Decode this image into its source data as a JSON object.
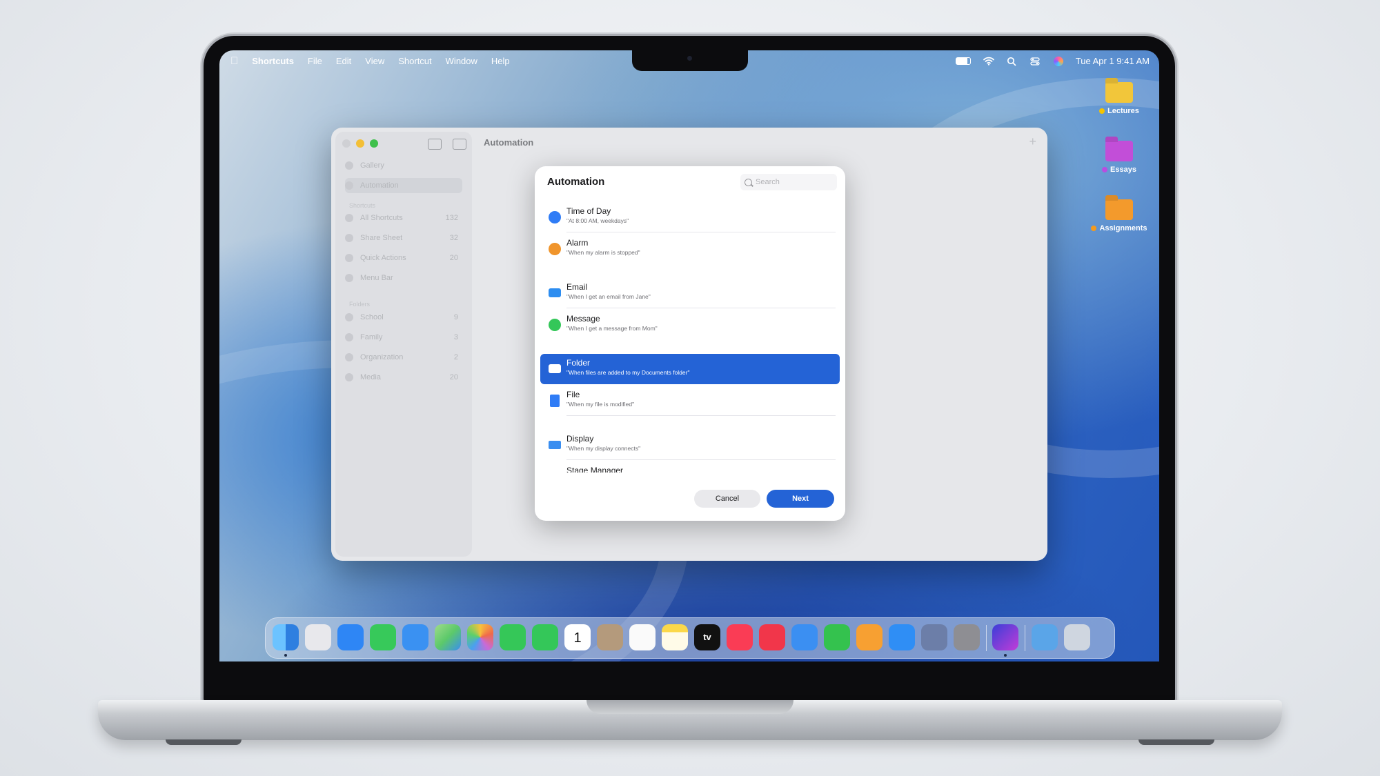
{
  "menubar": {
    "app_name": "Shortcuts",
    "menus": [
      "File",
      "Edit",
      "View",
      "Shortcut",
      "Window",
      "Help"
    ],
    "datetime": "Tue Apr 1  9:41 AM"
  },
  "desktop_folders": [
    {
      "label": "Lectures",
      "color": "#f2c63a",
      "tag": "#f5c400"
    },
    {
      "label": "Essays",
      "color": "#c24ed8",
      "tag": "#b94de0"
    },
    {
      "label": "Assignments",
      "color": "#f39a2c",
      "tag": "#f59a1c"
    }
  ],
  "window": {
    "title": "Automation",
    "sidebar": {
      "top_items": [
        {
          "label": "Gallery"
        },
        {
          "label": "Automation",
          "selected": true
        }
      ],
      "section1": "Shortcuts",
      "shortcut_items": [
        {
          "label": "All Shortcuts",
          "count": "132"
        },
        {
          "label": "Share Sheet",
          "count": "32"
        },
        {
          "label": "Quick Actions",
          "count": "20"
        },
        {
          "label": "Menu Bar",
          "count": ""
        }
      ],
      "section2": "Folders",
      "folder_items": [
        {
          "label": "School",
          "count": "9"
        },
        {
          "label": "Family",
          "count": "3"
        },
        {
          "label": "Organization",
          "count": "2"
        },
        {
          "label": "Media",
          "count": "20"
        }
      ]
    }
  },
  "dialog": {
    "title": "Automation",
    "search_placeholder": "Search",
    "rows": [
      {
        "title": "Time of Day",
        "subtitle": "\"At 8:00 AM, weekdays\"",
        "icon": "clock-icon",
        "color": "#2f7cf6"
      },
      {
        "title": "Alarm",
        "subtitle": "\"When my alarm is stopped\"",
        "icon": "alarm-icon",
        "color": "#f0952c"
      },
      {
        "title": "Email",
        "subtitle": "\"When I get an email from Jane\"",
        "icon": "mail-icon",
        "color": "#2d8df0"
      },
      {
        "title": "Message",
        "subtitle": "\"When I get a message from Mom\"",
        "icon": "message-icon",
        "color": "#34c759"
      },
      {
        "title": "Folder",
        "subtitle": "\"When files are added to my Documents folder\"",
        "icon": "folder-icon",
        "color": "#ffffff",
        "selected": true
      },
      {
        "title": "File",
        "subtitle": "\"When my file is modified\"",
        "icon": "file-icon",
        "color": "#2f7cf6"
      },
      {
        "title": "Display",
        "subtitle": "\"When my display connects\"",
        "icon": "display-icon",
        "color": "#3a8ef0"
      },
      {
        "title": "Stage Manager",
        "subtitle": "",
        "icon": "stage-manager-icon",
        "color": "#2f7cf6"
      }
    ],
    "cancel_label": "Cancel",
    "next_label": "Next"
  },
  "dock": {
    "apps": [
      {
        "name": "finder-icon",
        "color": "#4aa3f0"
      },
      {
        "name": "launchpad-icon",
        "color": "#e8e8ec"
      },
      {
        "name": "safari-icon",
        "color": "#2e86f5"
      },
      {
        "name": "messages-icon",
        "color": "#37c95a"
      },
      {
        "name": "mail-icon",
        "color": "#3a91f2"
      },
      {
        "name": "maps-icon",
        "color": "#5cc96a"
      },
      {
        "name": "photos-icon",
        "color": "#f4f4f6"
      },
      {
        "name": "facetime-icon",
        "color": "#35c758"
      },
      {
        "name": "phone-icon",
        "color": "#34c759"
      },
      {
        "name": "calendar-icon",
        "color": "#ffffff",
        "text": "1"
      },
      {
        "name": "contacts-icon",
        "color": "#b49a7c"
      },
      {
        "name": "reminders-icon",
        "color": "#fafafa"
      },
      {
        "name": "notes-icon",
        "color": "#fbd84a"
      },
      {
        "name": "tv-icon",
        "color": "#111111",
        "text": "tv"
      },
      {
        "name": "music-icon",
        "color": "#fa3c55"
      },
      {
        "name": "news-icon",
        "color": "#f1364a"
      },
      {
        "name": "keynote-icon",
        "color": "#3b8ff2"
      },
      {
        "name": "numbers-icon",
        "color": "#34c24e"
      },
      {
        "name": "pages-icon",
        "color": "#f7a032"
      },
      {
        "name": "app-store-icon",
        "color": "#2f8ef5"
      },
      {
        "name": "iphone-mirroring-icon",
        "color": "#6c7ea8"
      },
      {
        "name": "system-settings-icon",
        "color": "#8e8e93"
      },
      {
        "name": "shortcuts-icon",
        "color": "#8a3cd8"
      },
      {
        "name": "downloads-folder-icon",
        "color": "#5aa5e8"
      },
      {
        "name": "trash-icon",
        "color": "#cfd6e0"
      }
    ]
  }
}
